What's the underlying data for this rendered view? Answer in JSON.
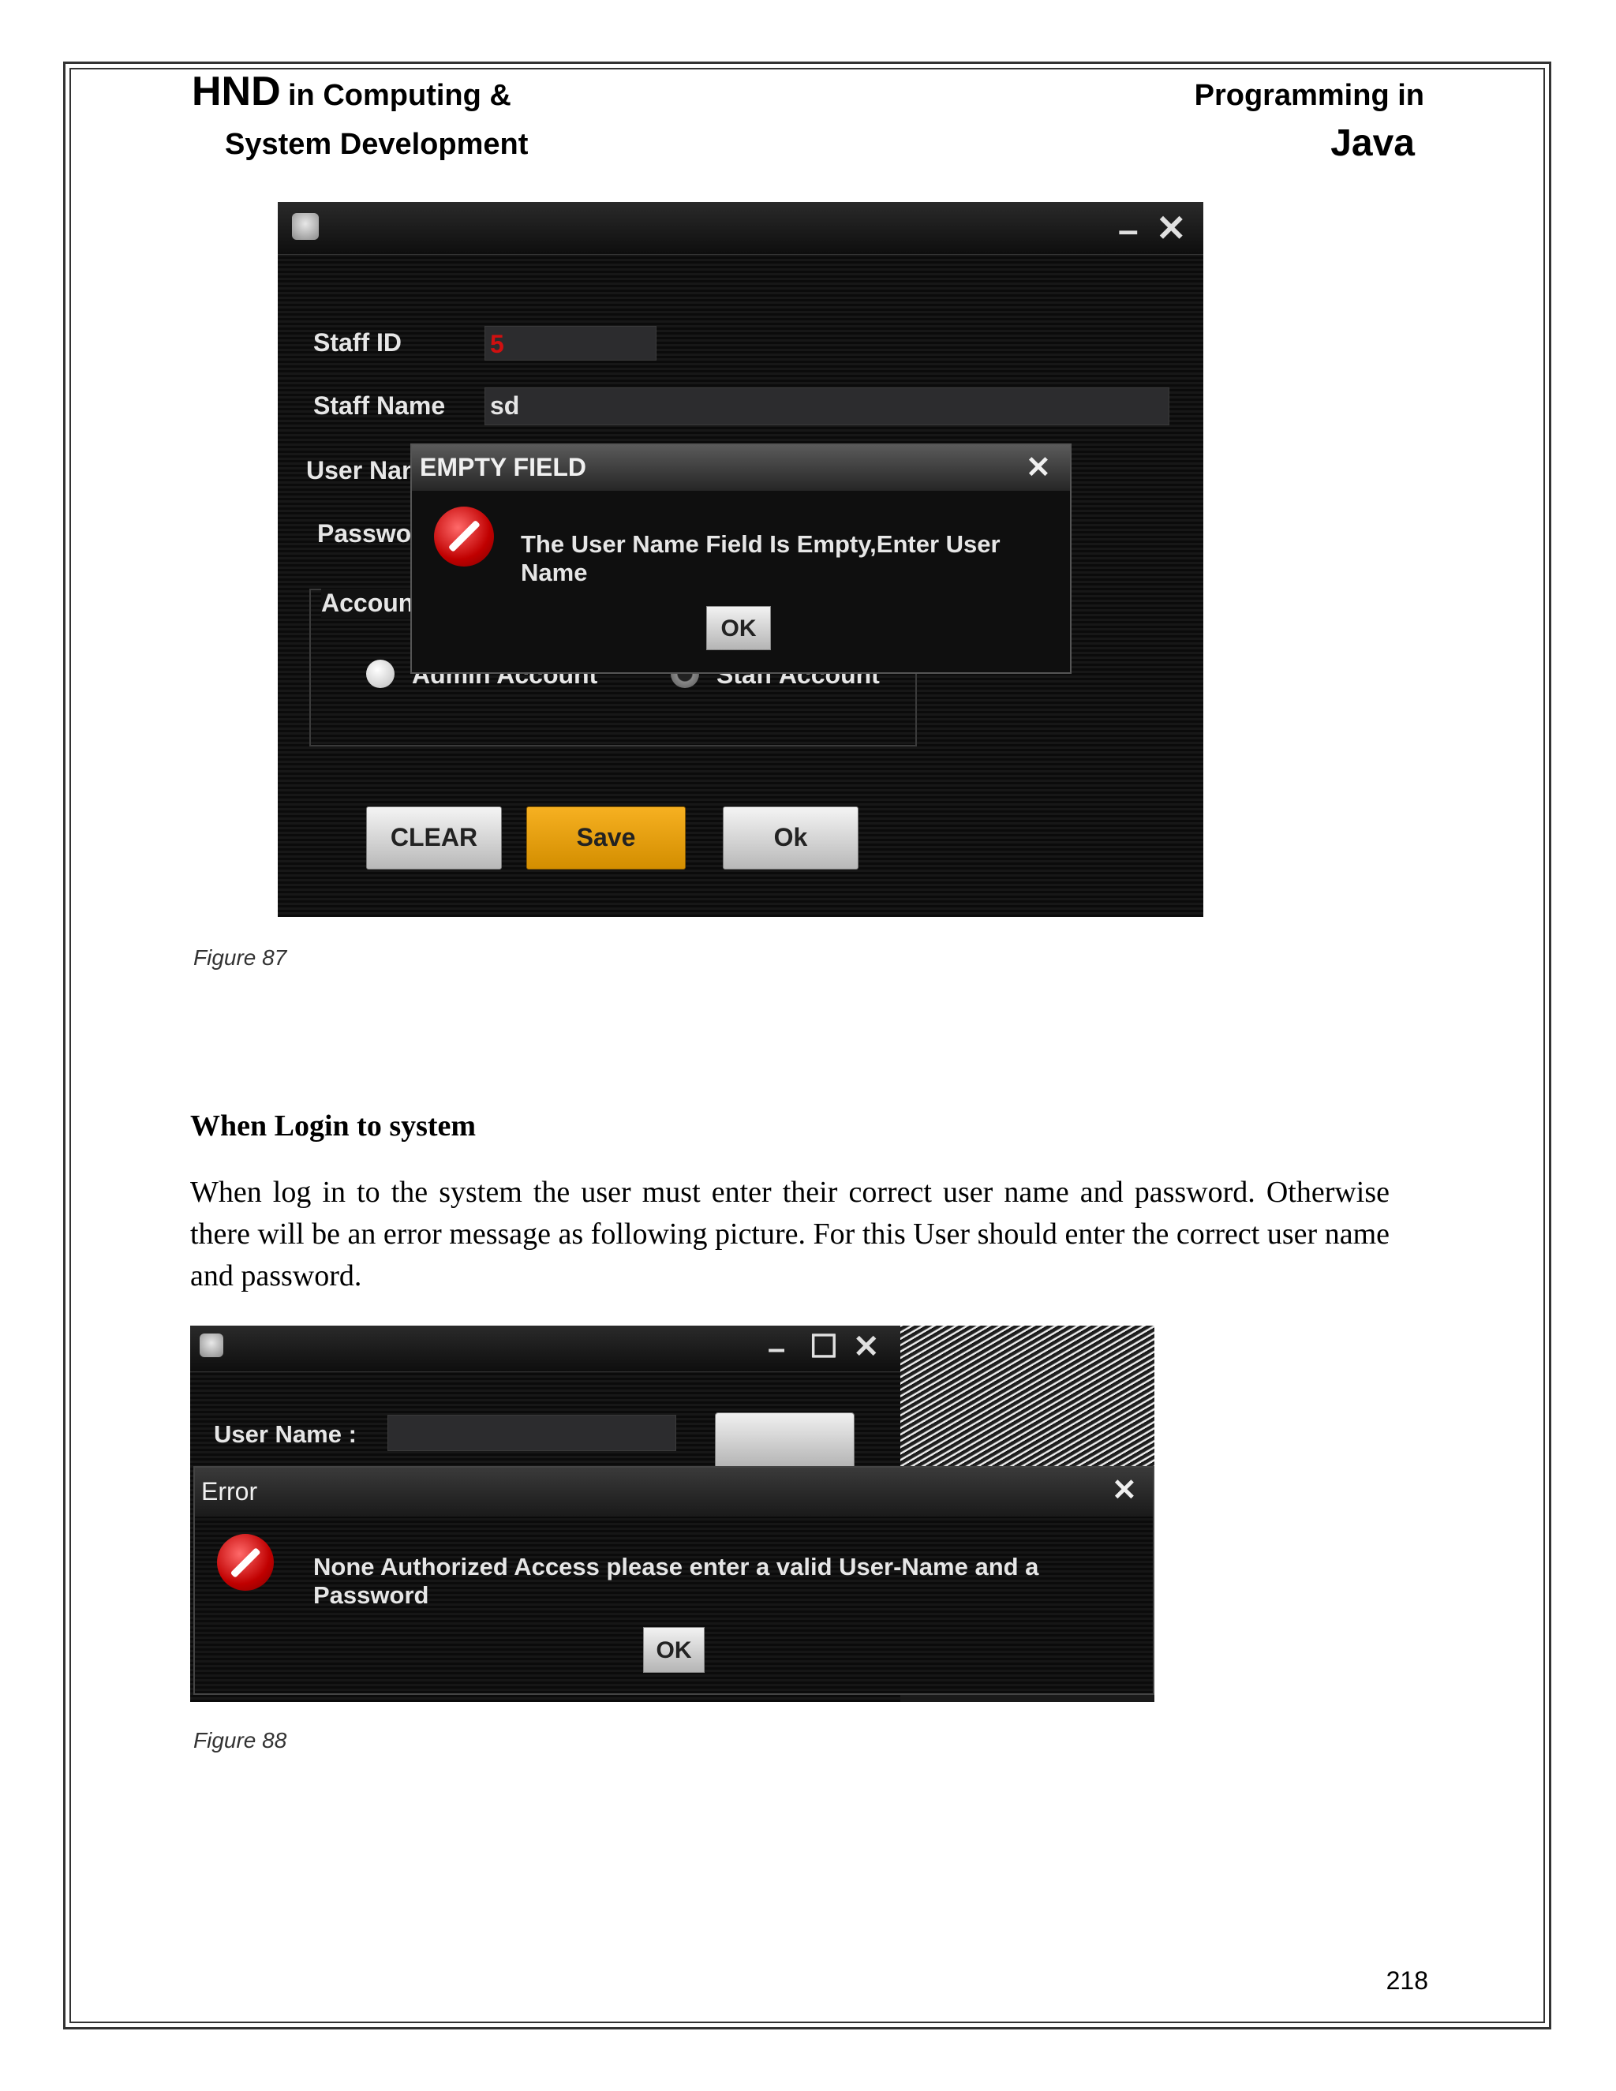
{
  "header": {
    "hnd": "HND",
    "line1_rest": "in Computing &",
    "line2": "System Development",
    "right_line1": "Programming in",
    "right_line2": "Java"
  },
  "figure87": {
    "window_controls": {
      "minimize": "–",
      "close": "✕"
    },
    "labels": {
      "staff_id": "Staff ID",
      "staff_name": "Staff Name",
      "user_name": "User Nan",
      "password": "Passwo",
      "account": "Accoun"
    },
    "fields": {
      "staff_id_value": "5",
      "staff_name_value": "sd"
    },
    "radios": {
      "admin": "Admin Account",
      "staff": "Staff Account"
    },
    "buttons": {
      "clear": "CLEAR",
      "save": "Save",
      "ok": "Ok"
    },
    "dialog": {
      "title": "EMPTY FIELD",
      "close": "✕",
      "message": "The User Name Field Is Empty,Enter User Name",
      "ok": "OK"
    },
    "caption": "Figure 87"
  },
  "section": {
    "heading": "When Login to system",
    "paragraph": "When log in to the system the user must enter their correct user name and password. Otherwise there will be an error message as following picture. For this User should enter the correct user name and password."
  },
  "figure88": {
    "window_controls": {
      "minimize": "–",
      "maximize": "☐",
      "close": "✕"
    },
    "user_name_label": "User Name :",
    "dialog": {
      "title": "Error",
      "close": "✕",
      "message": "None Authorized Access please enter a valid User-Name and a Password",
      "ok": "OK"
    },
    "caption": "Figure 88"
  },
  "page_number": "218"
}
